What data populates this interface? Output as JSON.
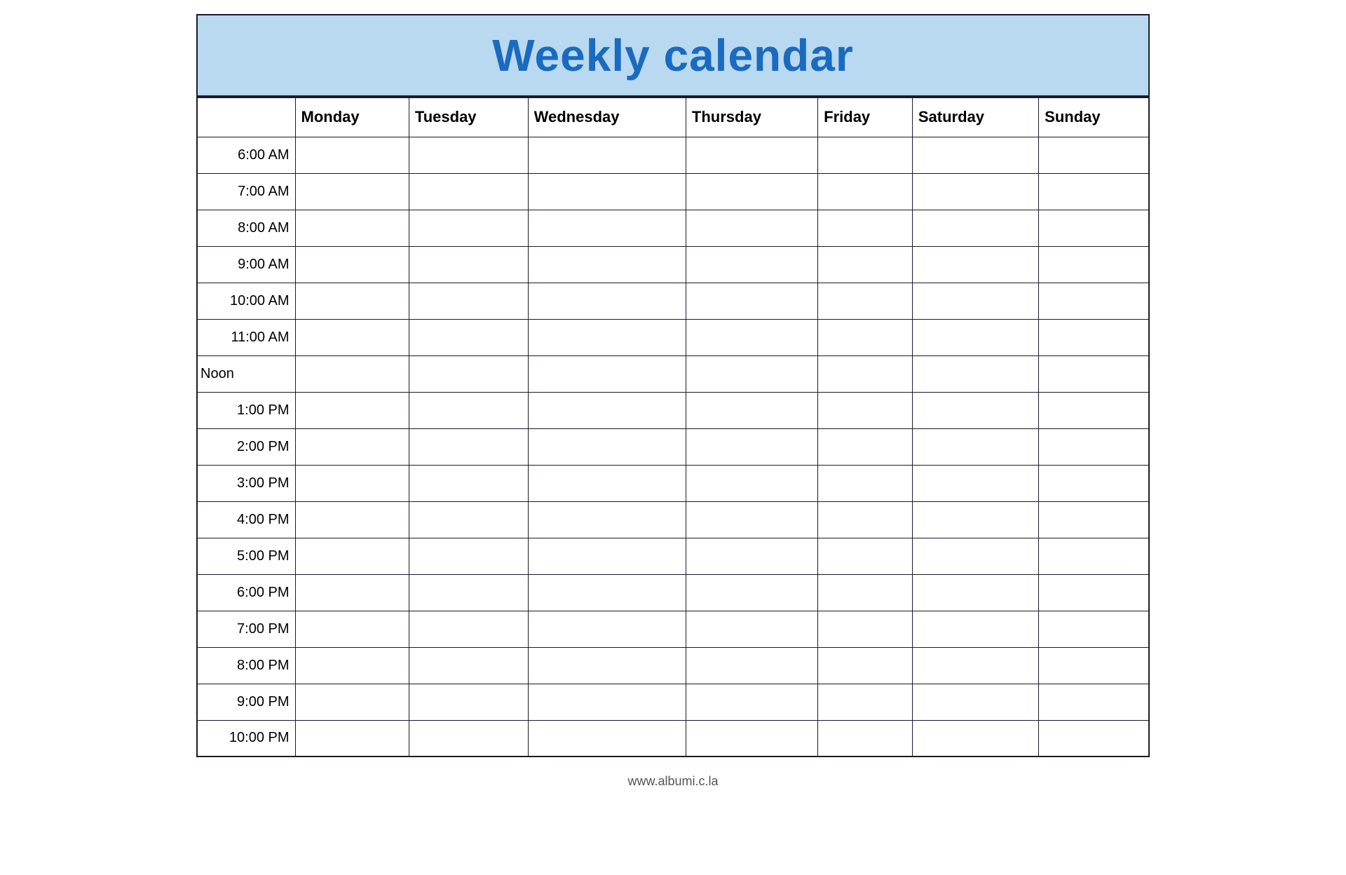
{
  "header": {
    "title": "Weekly calendar",
    "background_color": "#b8d9f0",
    "title_color": "#1a6bbf"
  },
  "columns": {
    "time_header": "",
    "days": [
      "Monday",
      "Tuesday",
      "Wednesday",
      "Thursday",
      "Friday",
      "Saturday",
      "Sunday"
    ]
  },
  "time_slots": [
    "6:00 AM",
    "7:00 AM",
    "8:00 AM",
    "9:00 AM",
    "10:00 AM",
    "11:00 AM",
    "Noon",
    "1:00 PM",
    "2:00 PM",
    "3:00 PM",
    "4:00 PM",
    "5:00 PM",
    "6:00 PM",
    "7:00 PM",
    "8:00 PM",
    "9:00 PM",
    "10:00 PM"
  ],
  "footer": {
    "url": "www.albumi.c.la"
  }
}
